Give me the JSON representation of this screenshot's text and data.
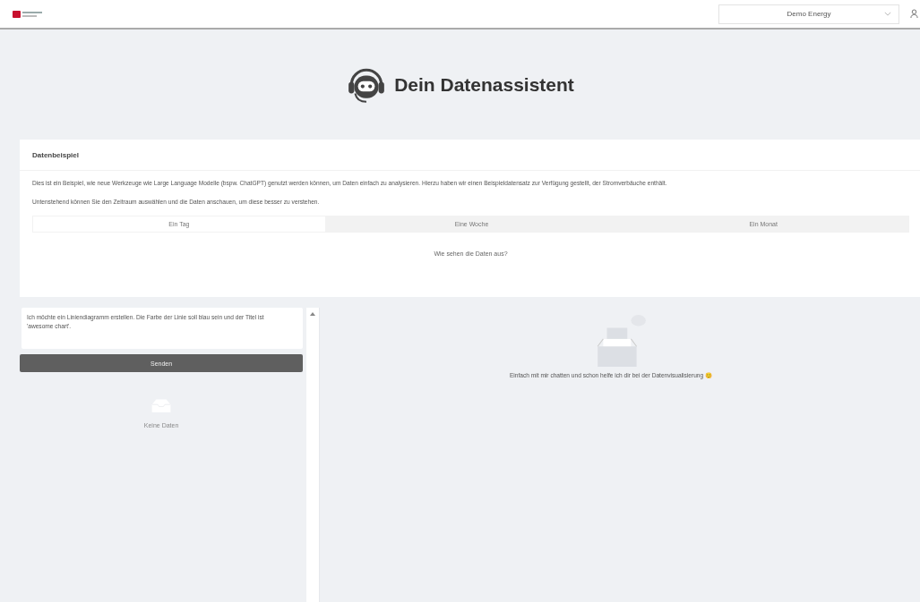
{
  "header": {
    "company_select": {
      "value": "Demo Energy"
    }
  },
  "title": "Dein Datenassistent",
  "example_card": {
    "heading": "Datenbeispiel",
    "paragraphs": [
      "Dies ist ein Beispiel, wie neue Werkzeuge wie Large Language Modelle (bspw. ChatGPT) genutzt werden können, um Daten einfach zu analysieren. Hierzu haben wir einen Beispieldatensatz zur Verfügung gestellt, der Stromverbäuche enthält.",
      "Untenstehend können Sie den Zeitraum auswählen und die Daten anschauen, um diese besser zu verstehen."
    ],
    "tabs": [
      {
        "label": "Ein Tag",
        "selected": true
      },
      {
        "label": "Eine Woche",
        "selected": false
      },
      {
        "label": "Ein Monat",
        "selected": false
      }
    ],
    "link": "Wie sehen die Daten aus?"
  },
  "chat": {
    "message": "Ich möchte ein Liniendiagramm erstellen. Die Farbe der Linie soll blau sein und der Titel ist 'awesome chart'.",
    "send_button": "Senden",
    "empty_text": "Keine Daten"
  },
  "visual": {
    "empty_text": "Einfach mit mir chatten und schon helfe ich dir bei der Datenvisualisierung 😊"
  }
}
